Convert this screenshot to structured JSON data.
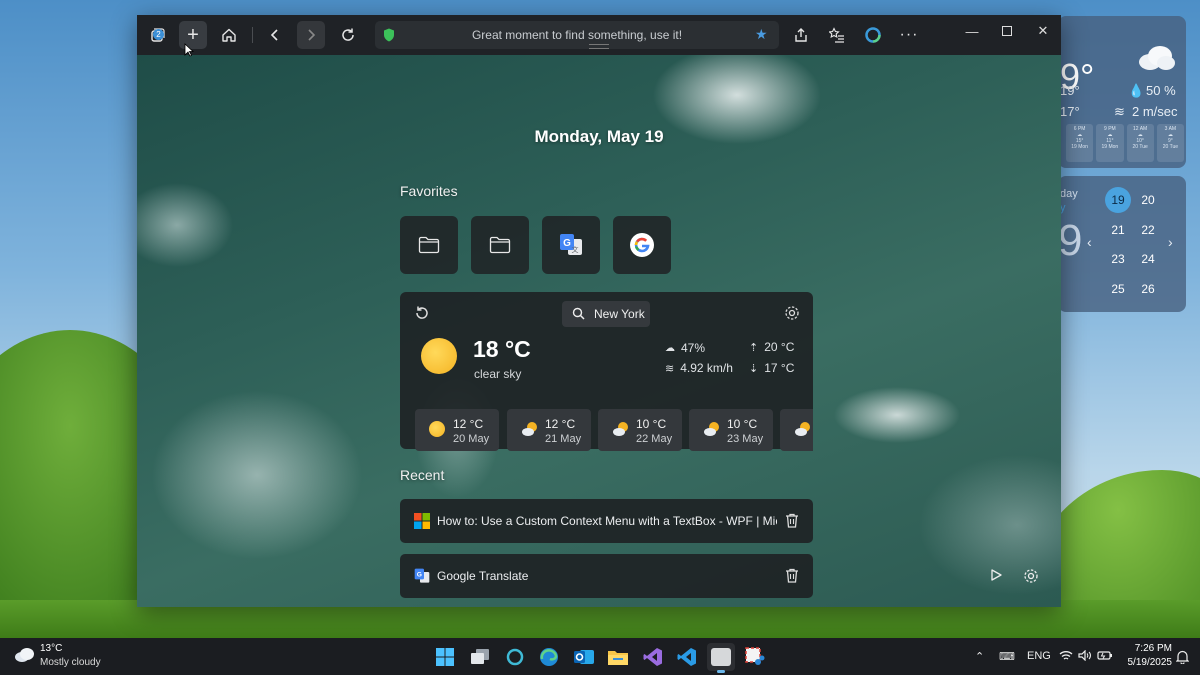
{
  "browser": {
    "tab_count": "2",
    "address_text": "Great moment to find something, use it!",
    "date_heading": "Monday, May 19",
    "favorites_title": "Favorites",
    "favorites": [
      {
        "name": "folder-icon"
      },
      {
        "name": "folder-icon"
      },
      {
        "name": "google-translate-icon"
      },
      {
        "name": "google-icon"
      }
    ],
    "weather": {
      "city": "New York",
      "temperature": "18 °C",
      "description": "clear sky",
      "humidity": "47%",
      "wind": "4.92 km/h",
      "high": "20 °C",
      "low": "17 °C",
      "forecast": [
        {
          "temp": "12 °C",
          "date": "20 May",
          "icon": "sun-icon"
        },
        {
          "temp": "12 °C",
          "date": "21 May",
          "icon": "partly-cloudy-icon"
        },
        {
          "temp": "10 °C",
          "date": "22 May",
          "icon": "partly-cloudy-icon"
        },
        {
          "temp": "10 °C",
          "date": "23 May",
          "icon": "partly-cloudy-icon"
        }
      ]
    },
    "recent_title": "Recent",
    "recent": [
      {
        "title": "How to: Use a Custom Context Menu with a TextBox - WPF | Micros...",
        "icon": "microsoft-icon"
      },
      {
        "title": "Google Translate",
        "icon": "google-translate-icon"
      }
    ],
    "accent_color": "#4a9be0"
  },
  "desktop_widgets": {
    "weather": {
      "temp_partial": "9°",
      "high_partial": "19°",
      "low_partial": "17°",
      "humidity": "50 %",
      "wind": "2 m/sec",
      "hours": [
        {
          "time": "6 PM",
          "temp": "15°",
          "date": "19 Mon"
        },
        {
          "time": "9 PM",
          "temp": "11°",
          "date": "19 Mon"
        },
        {
          "time": "12 AM",
          "temp": "10°",
          "date": "20 Tue"
        },
        {
          "time": "3 AM",
          "temp": "9°",
          "date": "20 Tue"
        }
      ]
    },
    "calendar": {
      "label_top": "day",
      "label_sub": "y",
      "big_number": "9",
      "days": [
        "19",
        "20",
        "21",
        "22",
        "23",
        "24",
        "25",
        "26"
      ],
      "today": "19"
    }
  },
  "taskbar": {
    "weather_temp": "13°C",
    "weather_desc": "Mostly cloudy",
    "language": "ENG",
    "time": "7:26 PM",
    "date": "5/19/2025",
    "apps": [
      "windows-start-icon",
      "task-view-icon",
      "cortana-icon",
      "edge-icon",
      "outlook-icon",
      "file-explorer-icon",
      "visual-studio-icon",
      "vscode-icon",
      "app-window-icon",
      "snipping-tool-icon"
    ]
  }
}
